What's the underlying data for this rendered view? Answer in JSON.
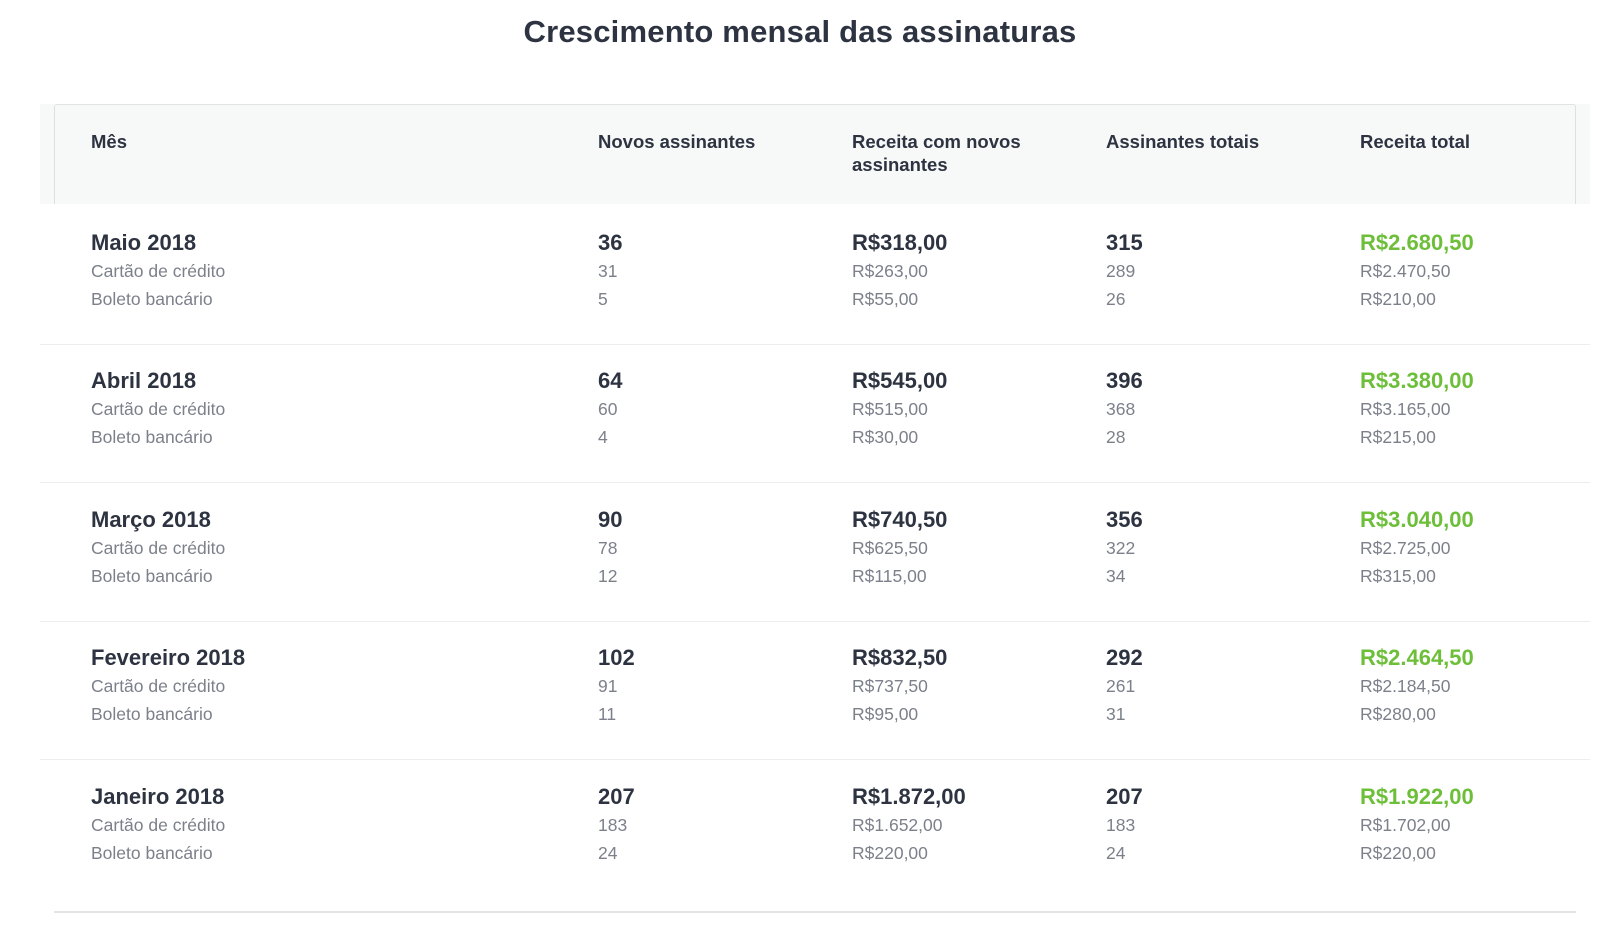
{
  "title": "Crescimento mensal das assinaturas",
  "colors": {
    "text_primary": "#2d3340",
    "text_secondary": "#7c808a",
    "accent_green": "#6dbf3a",
    "header_bg": "#f7f8f8"
  },
  "table": {
    "headers": {
      "month": "Mês",
      "new_subscribers": "Novos assinantes",
      "new_revenue": "Receita com novos assinantes",
      "total_subscribers": "Assinantes totais",
      "total_revenue": "Receita total"
    },
    "rows": [
      {
        "month": "Maio 2018",
        "card_label": "Cartão de crédito",
        "boleto_label": "Boleto bancário",
        "new_subscribers": {
          "total": "36",
          "card": "31",
          "boleto": "5"
        },
        "new_revenue": {
          "total": "R$318,00",
          "card": "R$263,00",
          "boleto": "R$55,00"
        },
        "total_subscribers": {
          "total": "315",
          "card": "289",
          "boleto": "26"
        },
        "total_revenue": {
          "total": "R$2.680,50",
          "card": "R$2.470,50",
          "boleto": "R$210,00"
        }
      },
      {
        "month": "Abril 2018",
        "card_label": "Cartão de crédito",
        "boleto_label": "Boleto bancário",
        "new_subscribers": {
          "total": "64",
          "card": "60",
          "boleto": "4"
        },
        "new_revenue": {
          "total": "R$545,00",
          "card": "R$515,00",
          "boleto": "R$30,00"
        },
        "total_subscribers": {
          "total": "396",
          "card": "368",
          "boleto": "28"
        },
        "total_revenue": {
          "total": "R$3.380,00",
          "card": "R$3.165,00",
          "boleto": "R$215,00"
        }
      },
      {
        "month": "Março 2018",
        "card_label": "Cartão de crédito",
        "boleto_label": "Boleto bancário",
        "new_subscribers": {
          "total": "90",
          "card": "78",
          "boleto": "12"
        },
        "new_revenue": {
          "total": "R$740,50",
          "card": "R$625,50",
          "boleto": "R$115,00"
        },
        "total_subscribers": {
          "total": "356",
          "card": "322",
          "boleto": "34"
        },
        "total_revenue": {
          "total": "R$3.040,00",
          "card": "R$2.725,00",
          "boleto": "R$315,00"
        }
      },
      {
        "month": "Fevereiro 2018",
        "card_label": "Cartão de crédito",
        "boleto_label": "Boleto bancário",
        "new_subscribers": {
          "total": "102",
          "card": "91",
          "boleto": "11"
        },
        "new_revenue": {
          "total": "R$832,50",
          "card": "R$737,50",
          "boleto": "R$95,00"
        },
        "total_subscribers": {
          "total": "292",
          "card": "261",
          "boleto": "31"
        },
        "total_revenue": {
          "total": "R$2.464,50",
          "card": "R$2.184,50",
          "boleto": "R$280,00"
        }
      },
      {
        "month": "Janeiro 2018",
        "card_label": "Cartão de crédito",
        "boleto_label": "Boleto bancário",
        "new_subscribers": {
          "total": "207",
          "card": "183",
          "boleto": "24"
        },
        "new_revenue": {
          "total": "R$1.872,00",
          "card": "R$1.652,00",
          "boleto": "R$220,00"
        },
        "total_subscribers": {
          "total": "207",
          "card": "183",
          "boleto": "24"
        },
        "total_revenue": {
          "total": "R$1.922,00",
          "card": "R$1.702,00",
          "boleto": "R$220,00"
        }
      }
    ]
  }
}
